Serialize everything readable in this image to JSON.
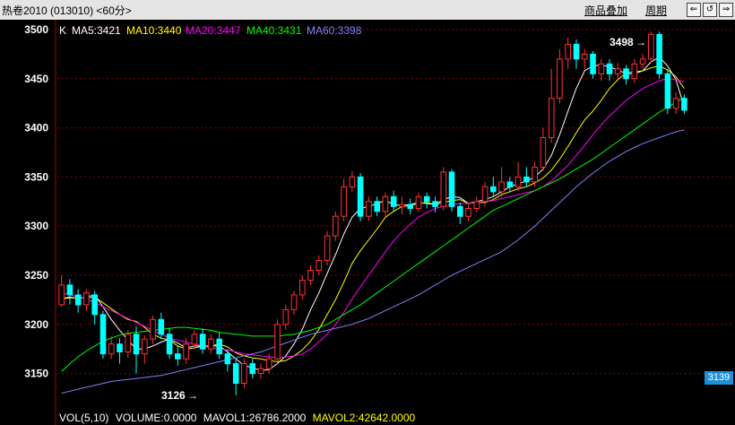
{
  "window": {
    "title": "热卷2010 (013010) <60分>",
    "overlay_label": "商品叠加",
    "period_label": "周期",
    "nav_icons": [
      "rewind-icon",
      "refresh-icon",
      "forward-icon"
    ]
  },
  "legend": {
    "k": "K",
    "ma5": "MA5:3421",
    "ma10": "MA10:3440",
    "ma20": "MA20:3447",
    "ma40": "MA40:3431",
    "ma60": "MA60:3398"
  },
  "annotations": {
    "high": "3498",
    "low": "3126"
  },
  "current_price": "3139",
  "volume_row": {
    "vol": "VOL(5,10)",
    "volume": "VOLUME:0.0000",
    "mavol1": "MAVOL1:26786.2000",
    "mavol2": "MAVOL2:42642.0000"
  },
  "colors": {
    "background": "#000000",
    "up": "#ff3232",
    "down": "#00ffff",
    "ma5": "#ffffff",
    "ma10": "#ffff00",
    "ma20": "#ff00ff",
    "ma40": "#00ff00",
    "ma60": "#8080ff",
    "grid": "#8b0000"
  },
  "chart_data": {
    "type": "candlestick",
    "ylim": [
      3125,
      3510
    ],
    "yticks": [
      3150,
      3200,
      3250,
      3300,
      3350,
      3400,
      3450,
      3500
    ],
    "grid": true,
    "candles": [
      [
        3220,
        3240,
        3250,
        3218
      ],
      [
        3240,
        3230,
        3246,
        3220
      ],
      [
        3230,
        3220,
        3236,
        3212
      ],
      [
        3220,
        3232,
        3236,
        3214
      ],
      [
        3230,
        3210,
        3234,
        3200
      ],
      [
        3210,
        3170,
        3214,
        3165
      ],
      [
        3170,
        3180,
        3188,
        3165
      ],
      [
        3180,
        3172,
        3186,
        3160
      ],
      [
        3172,
        3190,
        3194,
        3166
      ],
      [
        3190,
        3170,
        3198,
        3150
      ],
      [
        3170,
        3185,
        3189,
        3160
      ],
      [
        3185,
        3205,
        3209,
        3180
      ],
      [
        3205,
        3190,
        3212,
        3185
      ],
      [
        3190,
        3170,
        3196,
        3165
      ],
      [
        3170,
        3165,
        3178,
        3158
      ],
      [
        3165,
        3180,
        3186,
        3160
      ],
      [
        3180,
        3190,
        3194,
        3175
      ],
      [
        3190,
        3175,
        3196,
        3170
      ],
      [
        3175,
        3185,
        3190,
        3170
      ],
      [
        3185,
        3170,
        3192,
        3165
      ],
      [
        3170,
        3160,
        3174,
        3152
      ],
      [
        3160,
        3140,
        3164,
        3128
      ],
      [
        3140,
        3160,
        3165,
        3135
      ],
      [
        3160,
        3150,
        3165,
        3145
      ],
      [
        3150,
        3155,
        3160,
        3145
      ],
      [
        3155,
        3165,
        3170,
        3150
      ],
      [
        3165,
        3200,
        3205,
        3160
      ],
      [
        3200,
        3215,
        3220,
        3195
      ],
      [
        3215,
        3230,
        3234,
        3210
      ],
      [
        3230,
        3245,
        3250,
        3225
      ],
      [
        3245,
        3255,
        3260,
        3240
      ],
      [
        3255,
        3265,
        3270,
        3250
      ],
      [
        3265,
        3290,
        3295,
        3260
      ],
      [
        3290,
        3310,
        3315,
        3285
      ],
      [
        3310,
        3340,
        3348,
        3305
      ],
      [
        3340,
        3350,
        3356,
        3335
      ],
      [
        3350,
        3310,
        3354,
        3305
      ],
      [
        3310,
        3325,
        3330,
        3305
      ],
      [
        3325,
        3315,
        3330,
        3310
      ],
      [
        3315,
        3330,
        3334,
        3310
      ],
      [
        3330,
        3320,
        3336,
        3315
      ],
      [
        3320,
        3322,
        3330,
        3312
      ],
      [
        3322,
        3318,
        3328,
        3312
      ],
      [
        3318,
        3330,
        3334,
        3314
      ],
      [
        3330,
        3325,
        3334,
        3318
      ],
      [
        3325,
        3320,
        3330,
        3314
      ],
      [
        3320,
        3355,
        3360,
        3316
      ],
      [
        3355,
        3320,
        3358,
        3315
      ],
      [
        3320,
        3310,
        3324,
        3302
      ],
      [
        3310,
        3318,
        3322,
        3305
      ],
      [
        3318,
        3325,
        3330,
        3314
      ],
      [
        3325,
        3340,
        3345,
        3320
      ],
      [
        3340,
        3335,
        3350,
        3330
      ],
      [
        3335,
        3345,
        3360,
        3330
      ],
      [
        3345,
        3340,
        3350,
        3334
      ],
      [
        3340,
        3350,
        3365,
        3336
      ],
      [
        3350,
        3345,
        3360,
        3340
      ],
      [
        3345,
        3360,
        3365,
        3340
      ],
      [
        3360,
        3390,
        3400,
        3356
      ],
      [
        3390,
        3430,
        3460,
        3385
      ],
      [
        3430,
        3470,
        3480,
        3425
      ],
      [
        3470,
        3485,
        3492,
        3460
      ],
      [
        3485,
        3470,
        3490,
        3460
      ],
      [
        3470,
        3475,
        3480,
        3460
      ],
      [
        3475,
        3455,
        3478,
        3450
      ],
      [
        3455,
        3465,
        3470,
        3448
      ],
      [
        3465,
        3455,
        3470,
        3448
      ],
      [
        3455,
        3460,
        3466,
        3450
      ],
      [
        3460,
        3450,
        3464,
        3444
      ],
      [
        3450,
        3465,
        3470,
        3446
      ],
      [
        3465,
        3470,
        3475,
        3460
      ],
      [
        3470,
        3495,
        3498,
        3466
      ],
      [
        3495,
        3455,
        3498,
        3450
      ],
      [
        3455,
        3420,
        3460,
        3414
      ],
      [
        3420,
        3430,
        3436,
        3414
      ],
      [
        3430,
        3418,
        3434,
        3414
      ]
    ],
    "series": [
      {
        "name": "MA5",
        "values": [
          3226,
          3228,
          3226,
          3228,
          3230,
          3218,
          3205,
          3194,
          3184,
          3175,
          3175,
          3178,
          3182,
          3185,
          3181,
          3176,
          3178,
          3178,
          3178,
          3178,
          3172,
          3165,
          3158,
          3156,
          3153,
          3154,
          3160,
          3168,
          3180,
          3195,
          3215,
          3232,
          3252,
          3271,
          3292,
          3309,
          3318,
          3320,
          3323,
          3326,
          3322,
          3321,
          3322,
          3324,
          3323,
          3322,
          3327,
          3330,
          3329,
          3323,
          3325,
          3327,
          3330,
          3335,
          3340,
          3343,
          3346,
          3350,
          3358,
          3372,
          3393,
          3417,
          3440,
          3458,
          3463,
          3464,
          3462,
          3459,
          3455,
          3455,
          3458,
          3467,
          3472,
          3463,
          3449,
          3421
        ]
      },
      {
        "name": "MA10",
        "values": [
          3226,
          3227,
          3227,
          3227,
          3228,
          3222,
          3216,
          3210,
          3205,
          3203,
          3197,
          3190,
          3186,
          3184,
          3178,
          3175,
          3176,
          3178,
          3178,
          3180,
          3177,
          3171,
          3168,
          3166,
          3165,
          3163,
          3162,
          3163,
          3168,
          3174,
          3183,
          3195,
          3210,
          3225,
          3243,
          3262,
          3275,
          3286,
          3297,
          3309,
          3315,
          3320,
          3321,
          3323,
          3324,
          3322,
          3324,
          3326,
          3327,
          3323,
          3324,
          3324,
          3327,
          3332,
          3335,
          3338,
          3340,
          3344,
          3349,
          3357,
          3368,
          3381,
          3395,
          3408,
          3417,
          3428,
          3440,
          3449,
          3456,
          3457,
          3458,
          3461,
          3463,
          3459,
          3452,
          3440
        ]
      },
      {
        "name": "MA20",
        "values": [
          3232,
          3230,
          3228,
          3226,
          3222,
          3218,
          3214,
          3210,
          3206,
          3202,
          3198,
          3194,
          3190,
          3186,
          3184,
          3182,
          3180,
          3178,
          3176,
          3175,
          3174,
          3172,
          3170,
          3169,
          3168,
          3167,
          3166,
          3167,
          3168,
          3170,
          3175,
          3182,
          3190,
          3200,
          3212,
          3226,
          3238,
          3250,
          3262,
          3274,
          3285,
          3294,
          3302,
          3309,
          3314,
          3318,
          3320,
          3322,
          3323,
          3323,
          3324,
          3325,
          3326,
          3328,
          3330,
          3332,
          3334,
          3336,
          3340,
          3346,
          3354,
          3362,
          3372,
          3382,
          3393,
          3403,
          3412,
          3420,
          3428,
          3434,
          3440,
          3444,
          3448,
          3450,
          3449,
          3447
        ]
      },
      {
        "name": "MA40",
        "values": [
          3152,
          3160,
          3167,
          3173,
          3178,
          3183,
          3186,
          3189,
          3191,
          3192,
          3193,
          3194,
          3195,
          3196,
          3197,
          3197,
          3196,
          3195,
          3194,
          3192,
          3191,
          3190,
          3189,
          3188,
          3188,
          3188,
          3188,
          3189,
          3190,
          3192,
          3194,
          3197,
          3200,
          3205,
          3210,
          3215,
          3220,
          3226,
          3232,
          3238,
          3244,
          3250,
          3256,
          3262,
          3268,
          3274,
          3280,
          3286,
          3292,
          3298,
          3304,
          3310,
          3316,
          3320,
          3324,
          3328,
          3332,
          3336,
          3340,
          3344,
          3348,
          3353,
          3358,
          3363,
          3368,
          3374,
          3380,
          3386,
          3392,
          3398,
          3404,
          3410,
          3416,
          3421,
          3426,
          3431
        ]
      },
      {
        "name": "MA60",
        "values": [
          3130,
          3132,
          3134,
          3136,
          3138,
          3140,
          3142,
          3143,
          3144,
          3145,
          3146,
          3147,
          3148,
          3150,
          3152,
          3154,
          3156,
          3158,
          3160,
          3162,
          3164,
          3166,
          3168,
          3170,
          3172,
          3175,
          3178,
          3181,
          3184,
          3187,
          3190,
          3192,
          3194,
          3196,
          3198,
          3200,
          3203,
          3206,
          3210,
          3214,
          3218,
          3222,
          3226,
          3230,
          3235,
          3240,
          3245,
          3250,
          3254,
          3258,
          3262,
          3266,
          3270,
          3274,
          3280,
          3286,
          3293,
          3300,
          3308,
          3316,
          3324,
          3332,
          3340,
          3347,
          3354,
          3360,
          3366,
          3371,
          3376,
          3380,
          3384,
          3387,
          3390,
          3393,
          3396,
          3398
        ]
      }
    ]
  }
}
